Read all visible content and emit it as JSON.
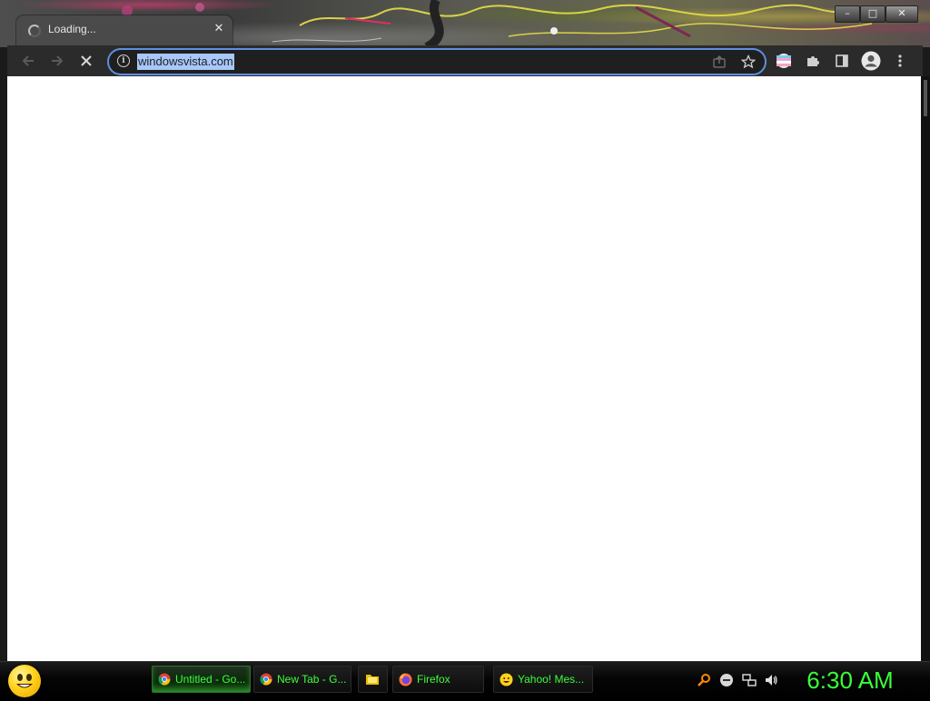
{
  "tab": {
    "title": "Loading...",
    "close_symbol": "✕",
    "icon": "loading-spinner-icon"
  },
  "window_controls": {
    "minimize_symbol": "–",
    "maximize_symbol": "□",
    "close_symbol": "✕"
  },
  "toolbar": {
    "back_icon": "arrow-left-icon",
    "forward_icon": "arrow-right-icon",
    "stop_icon": "stop-loading-icon",
    "omnibox": {
      "info_symbol": "i",
      "url": "windowsvista.com",
      "url_selected": true,
      "share_icon": "share-icon",
      "bookmark_icon": "star-icon"
    },
    "right_icons": [
      "extension-profile-icon",
      "puzzle-extensions-icon",
      "side-panel-icon",
      "account-avatar-icon",
      "kebab-menu-icon"
    ]
  },
  "taskbar": {
    "start_icon": "smiley-start-icon",
    "tasks": [
      {
        "label": "Untitled - Go...",
        "icon": "chrome-icon",
        "active": true
      },
      {
        "label": "New Tab - G...",
        "icon": "chrome-icon",
        "active": false
      },
      {
        "label": "",
        "icon": "folder-icon",
        "active": false
      },
      {
        "label": "Firefox",
        "icon": "firefox-icon",
        "active": false
      },
      {
        "label": "Yahoo! Mes...",
        "icon": "yahoo-messenger-icon",
        "active": false
      }
    ],
    "tray_icons": [
      "search-tray-icon",
      "minus-circle-tray-icon",
      "network-tray-icon",
      "volume-tray-icon"
    ],
    "clock": "6:30 AM"
  },
  "colors": {
    "accent_green": "#39ff39",
    "omnibox_focus": "#5f8ee0",
    "selection": "#a8c7fa"
  }
}
